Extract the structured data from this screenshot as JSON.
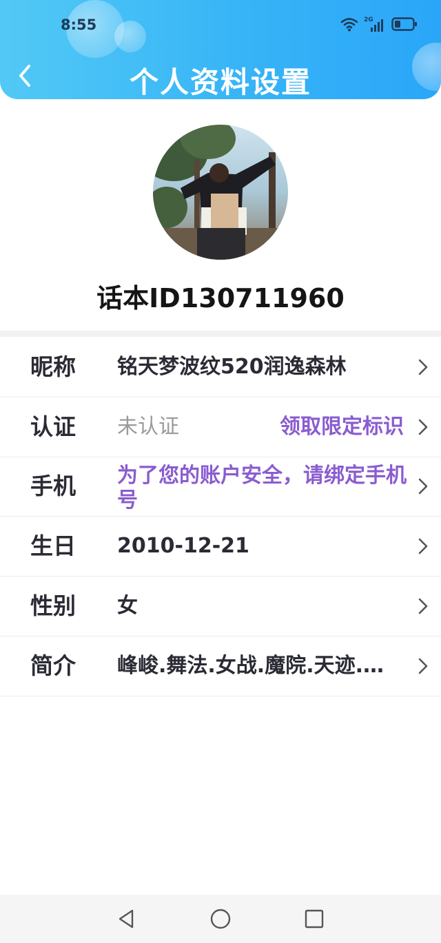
{
  "status_bar": {
    "time": "8:55",
    "network": "2G"
  },
  "header": {
    "title": "个人资料设置"
  },
  "profile": {
    "user_id": "话本ID130711960"
  },
  "fields": [
    {
      "label": "昵称",
      "value": "铭天梦波纹520润逸森林"
    },
    {
      "label": "认证",
      "value": "未认证",
      "action": "领取限定标识"
    },
    {
      "label": "手机",
      "value": "为了您的账户安全，请绑定手机号"
    },
    {
      "label": "生日",
      "value": "2010-12-21"
    },
    {
      "label": "性别",
      "value": "女"
    },
    {
      "label": "简介",
      "value": "峰峻.舞法.女战.魔院.天迹.…"
    }
  ],
  "colors": {
    "header_start": "#52c9f5",
    "header_end": "#2aa6f8",
    "accent_purple": "#8a5cd0",
    "label_text": "#2b2b35",
    "muted_text": "#9a9a9a"
  },
  "icons": {
    "back": "chevron-left-icon",
    "row_arrow": "chevron-right-icon",
    "nav_back": "triangle-back-icon",
    "nav_home": "circle-home-icon",
    "nav_recent": "square-recent-icon"
  }
}
